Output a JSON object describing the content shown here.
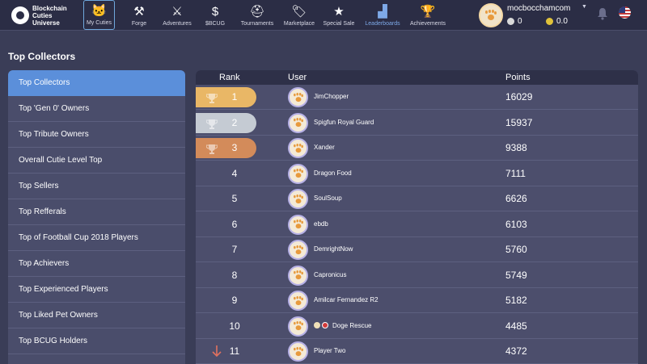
{
  "brand": {
    "name_line1": "Blockchain",
    "name_line2": "Cuties Universe"
  },
  "nav": [
    {
      "label": "My Cuties",
      "icon": "cat-face-icon",
      "glyph": "🐱",
      "x": 0
    },
    {
      "label": "Forge",
      "icon": "anvil-icon",
      "glyph": "⚒"
    },
    {
      "label": "Adventures",
      "icon": "crossed-swords-icon",
      "glyph": "⚔"
    },
    {
      "label": "$BCUG",
      "icon": "bcug-token-icon",
      "glyph": "$"
    },
    {
      "label": "Tournaments",
      "icon": "helmet-icon",
      "glyph": "⛑"
    },
    {
      "label": "Marketplace",
      "icon": "tag-icon",
      "glyph": "🏷"
    },
    {
      "label": "Special Sale",
      "icon": "star-icon",
      "glyph": "★"
    },
    {
      "label": "Leaderboards",
      "icon": "podium-icon",
      "glyph": "▟"
    },
    {
      "label": "Achievements",
      "icon": "trophy-icon",
      "glyph": "🏆"
    }
  ],
  "account": {
    "username": "mocbocchamcom",
    "balance_a": "0",
    "balance_b": "0.0"
  },
  "page": {
    "title": "Top Collectors"
  },
  "sidebar": {
    "items": [
      "Top Collectors",
      "Top 'Gen 0' Owners",
      "Top Tribute Owners",
      "Overall Cutie Level Top",
      "Top Sellers",
      "Top Refferals",
      "Top of Football Cup 2018 Players",
      "Top Achievers",
      "Top Experienced Players",
      "Top Liked Pet Owners",
      "Top BCUG Holders"
    ],
    "active_index": 0
  },
  "table": {
    "headers": {
      "rank": "Rank",
      "user": "User",
      "points": "Points"
    },
    "rows": [
      {
        "rank": "1",
        "user": "JimChopper",
        "points": "16029",
        "medal": "gold"
      },
      {
        "rank": "2",
        "user": "Spigfun Royal Guard",
        "points": "15937",
        "medal": "silver"
      },
      {
        "rank": "3",
        "user": "Xander",
        "points": "9388",
        "medal": "bronze"
      },
      {
        "rank": "4",
        "user": "Dragon Food",
        "points": "7111"
      },
      {
        "rank": "5",
        "user": "SoulSoup",
        "points": "6626"
      },
      {
        "rank": "6",
        "user": "ebdb",
        "points": "6103"
      },
      {
        "rank": "7",
        "user": "DemrightNow",
        "points": "5760"
      },
      {
        "rank": "8",
        "user": "Capronicus",
        "points": "5749"
      },
      {
        "rank": "9",
        "user": "Amilcar Fernandez R2",
        "points": "5182"
      },
      {
        "rank": "10",
        "user": "Doge Rescue",
        "points": "4485",
        "badges": true
      },
      {
        "rank": "11",
        "user": "Player Two",
        "points": "4372",
        "trend": "down"
      }
    ]
  },
  "colors": {
    "gold": "#e9b766",
    "silver": "#c5cbd3",
    "bronze": "#d38b5a",
    "accent": "#5b8fda",
    "trend_down": "#e0715f"
  }
}
